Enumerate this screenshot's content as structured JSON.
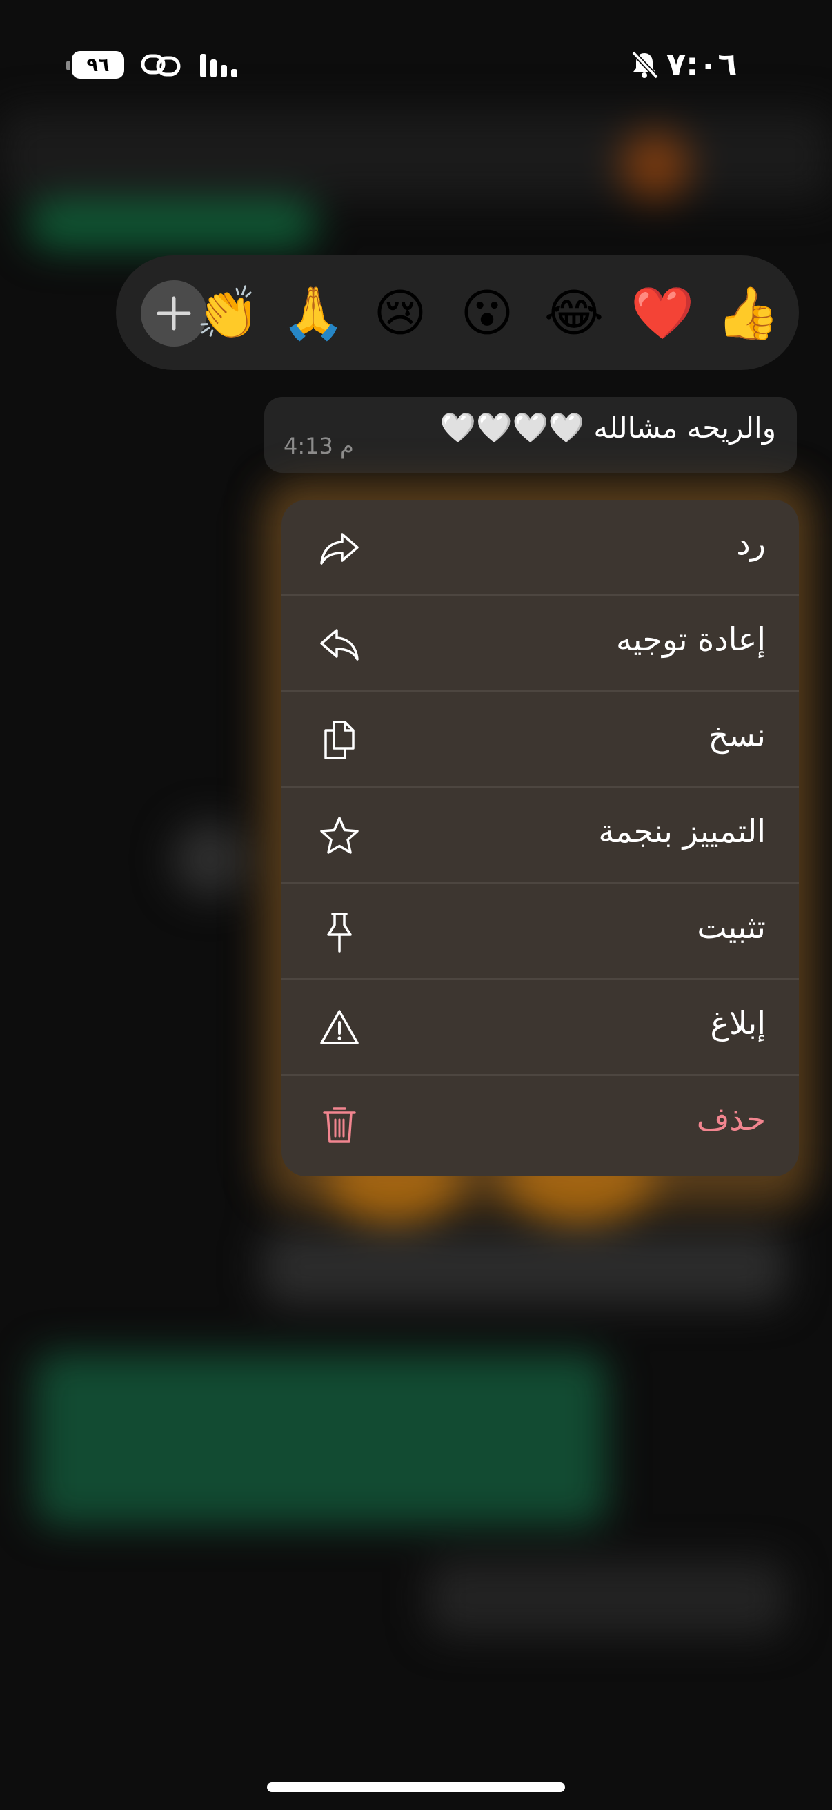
{
  "status_bar": {
    "time": "٧:٠٦",
    "battery": "٩٦"
  },
  "reactions": {
    "emojis": [
      "👍",
      "❤️",
      "😂",
      "😮",
      "😢",
      "🙏",
      "👏"
    ]
  },
  "message": {
    "text": "والريحه مشالله 🤍🤍🤍🤍",
    "time": "4:13 م"
  },
  "menu": {
    "items": [
      {
        "label": "رد",
        "icon": "reply-icon"
      },
      {
        "label": "إعادة توجيه",
        "icon": "forward-icon"
      },
      {
        "label": "نسخ",
        "icon": "copy-icon"
      },
      {
        "label": "التمييز بنجمة",
        "icon": "star-icon"
      },
      {
        "label": "تثبيت",
        "icon": "pin-icon"
      },
      {
        "label": "إبلاغ",
        "icon": "warning-icon"
      },
      {
        "label": "حذف",
        "icon": "trash-icon"
      }
    ]
  },
  "colors": {
    "menu_bg": "#3d3630",
    "danger": "#f2858f",
    "bubble_bg": "#242424"
  }
}
